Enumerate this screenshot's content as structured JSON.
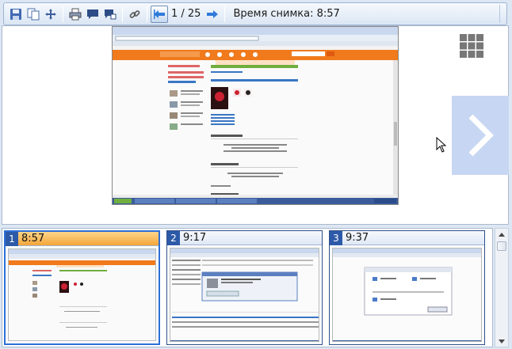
{
  "toolbar": {
    "icons": [
      "save-icon",
      "copy-icon",
      "move-icon",
      "print-icon",
      "comment-icon",
      "comment-edit-icon",
      "link-icon",
      "prev-icon",
      "next-icon"
    ],
    "page_counter": "1 / 25",
    "capture_time": "Время снимка: 8:57"
  },
  "viewer": {
    "grid_icon": "grid-icon",
    "next_icon": "chevron-right-icon"
  },
  "thumbnails": [
    {
      "number": "1",
      "time": "8:57",
      "selected": true
    },
    {
      "number": "2",
      "time": "9:17",
      "selected": false
    },
    {
      "number": "3",
      "time": "9:37",
      "selected": false
    }
  ],
  "colors": {
    "accent": "#2d5aa8",
    "selected_header": "#f4a63a",
    "orange_site": "#f07a1c",
    "next_panel": "#c7d6f2"
  }
}
